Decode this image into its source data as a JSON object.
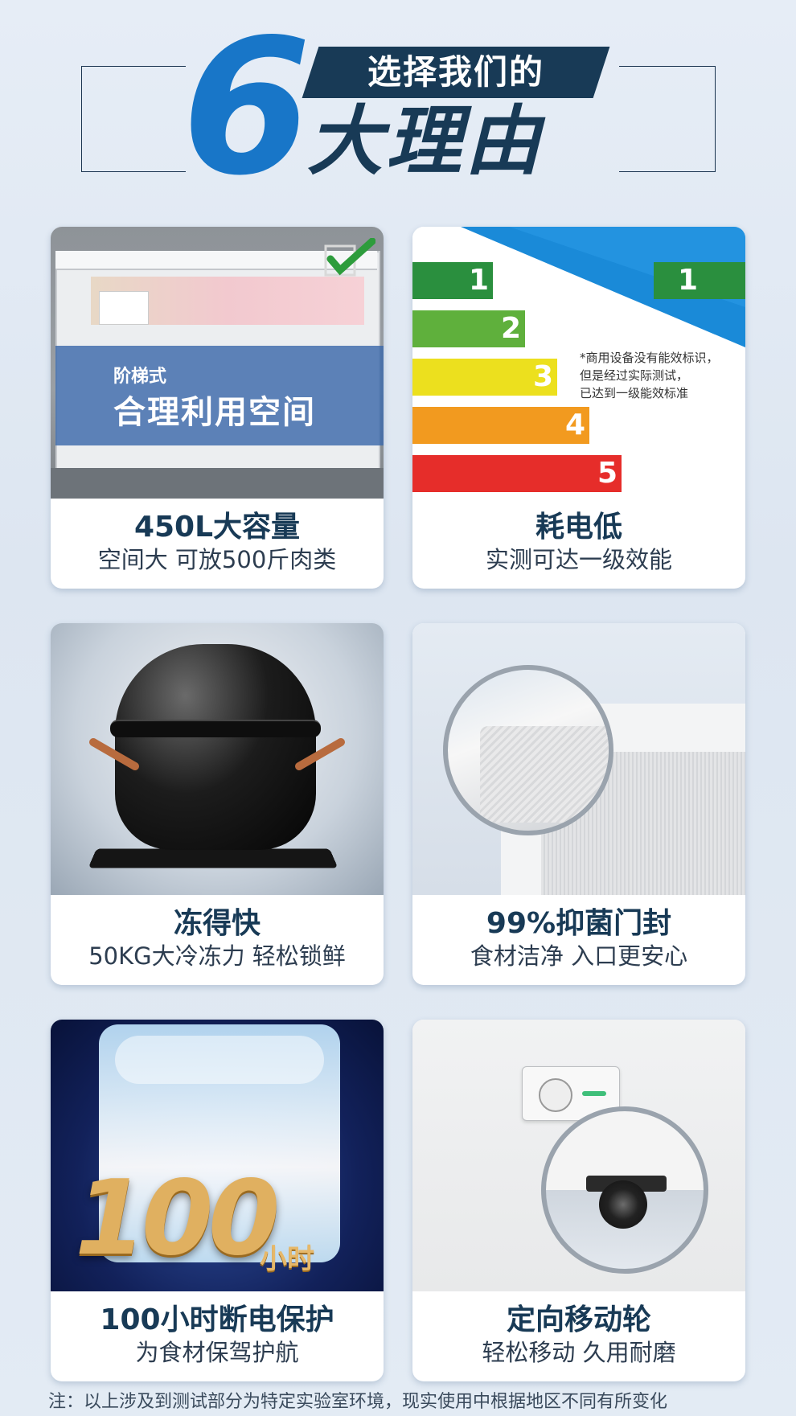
{
  "header": {
    "number": "6",
    "banner_text": "选择我们的",
    "main_text": "大理由",
    "colors": {
      "number": "#1876c8",
      "navy": "#183a56"
    }
  },
  "cards": [
    {
      "title": "450L大容量",
      "subtitle": "空间大 可放500斤肉类",
      "overlay_small": "阶梯式",
      "overlay_big": "合理利用空间",
      "image": "chest-freezer-photo"
    },
    {
      "title": "耗电低",
      "subtitle": "实测可达一级效能",
      "energy_levels": [
        "1",
        "2",
        "3",
        "4",
        "5"
      ],
      "energy_badge": "1",
      "note_lines": [
        "*商用设备没有能效标识，",
        "但是经过实际测试，",
        "已达到一级能效标准"
      ],
      "image": "energy-label-graphic"
    },
    {
      "title": "冻得快",
      "subtitle": "50KG大冷冻力 轻松锁鲜",
      "image": "compressor-photo"
    },
    {
      "title": "99%抑菌门封",
      "subtitle": "食材洁净 入口更安心",
      "image": "door-seal-closeup"
    },
    {
      "title": "100小时断电保护",
      "subtitle": "为食材保驾护航",
      "big_number": "100",
      "big_number_unit": "小时",
      "image": "ice-block-photo"
    },
    {
      "title": "定向移动轮",
      "subtitle": "轻松移动  久用耐磨",
      "image": "caster-wheel-closeup"
    }
  ],
  "footnote": "注：以上涉及到测试部分为特定实验室环境，现实使用中根据地区不同有所变化"
}
